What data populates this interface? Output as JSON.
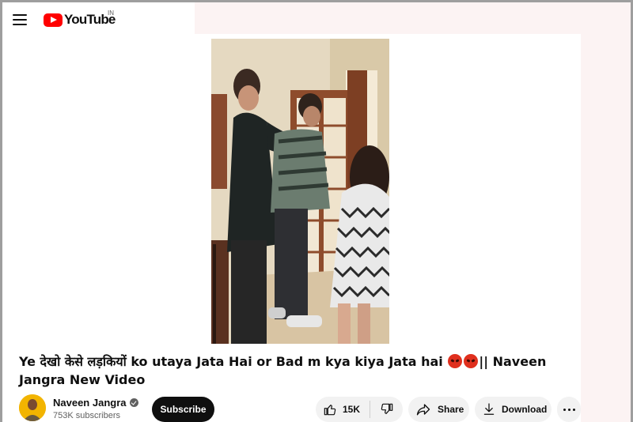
{
  "masthead": {
    "logo_text": "YouTube",
    "country_code": "IN",
    "menu_icon": "hamburger-menu-icon"
  },
  "video": {
    "title_part1": "Ye देखो केसे लड़कियों ko utaya Jata Hai or Bad m kya kiya Jata hai",
    "title_emoji": "angry-face-emoji",
    "title_part2": "|| Naveen Jangra New Video"
  },
  "channel": {
    "name": "Naveen Jangra",
    "subscribers": "753K subscribers",
    "verified_icon": "verified-check-icon"
  },
  "actions": {
    "subscribe_label": "Subscribe",
    "like_count": "15K",
    "share_label": "Share",
    "download_label": "Download"
  },
  "colors": {
    "brand_red": "#ff0000",
    "button_dark": "#0f0f0f",
    "pill_bg": "#f2f2f2",
    "side_tint": "#fcf3f3"
  }
}
